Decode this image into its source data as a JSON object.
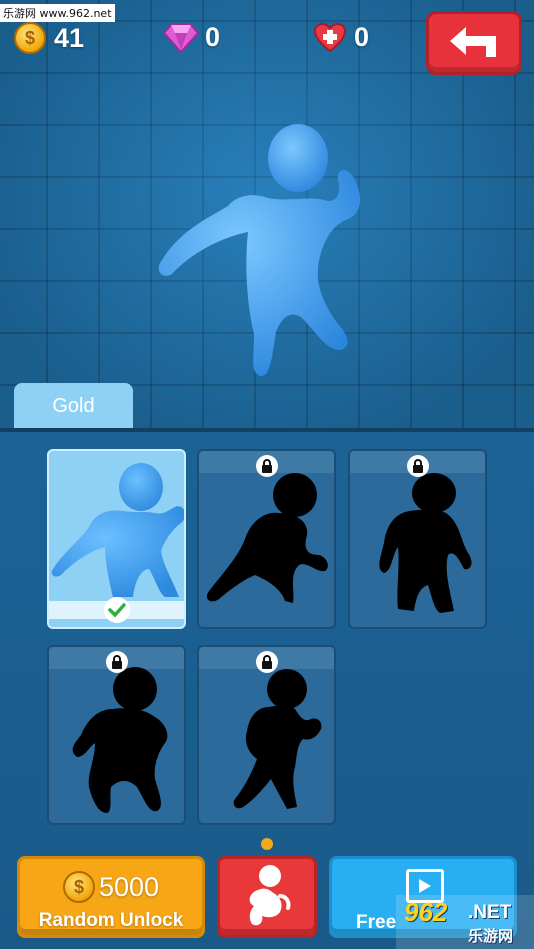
{
  "watermark_top": "乐游网 www.962.net",
  "stats": {
    "coins": "41",
    "gems": "0",
    "hearts": "0",
    "coin_symbol": "$"
  },
  "tab": {
    "label": "Gold"
  },
  "cards": [
    {
      "state": "selected"
    },
    {
      "state": "locked"
    },
    {
      "state": "locked"
    },
    {
      "state": "locked"
    },
    {
      "state": "locked"
    }
  ],
  "buttons": {
    "random_price": "5000",
    "random_label": "Random Unlock",
    "free_label": "Free"
  },
  "watermark_bottom": {
    "big": "962",
    "net": ".NET",
    "cn": "乐游网"
  },
  "colors": {
    "hero": "#4aa8f0",
    "accent_orange": "#f7a615",
    "accent_red": "#e8323b",
    "accent_blue": "#28aef3"
  }
}
